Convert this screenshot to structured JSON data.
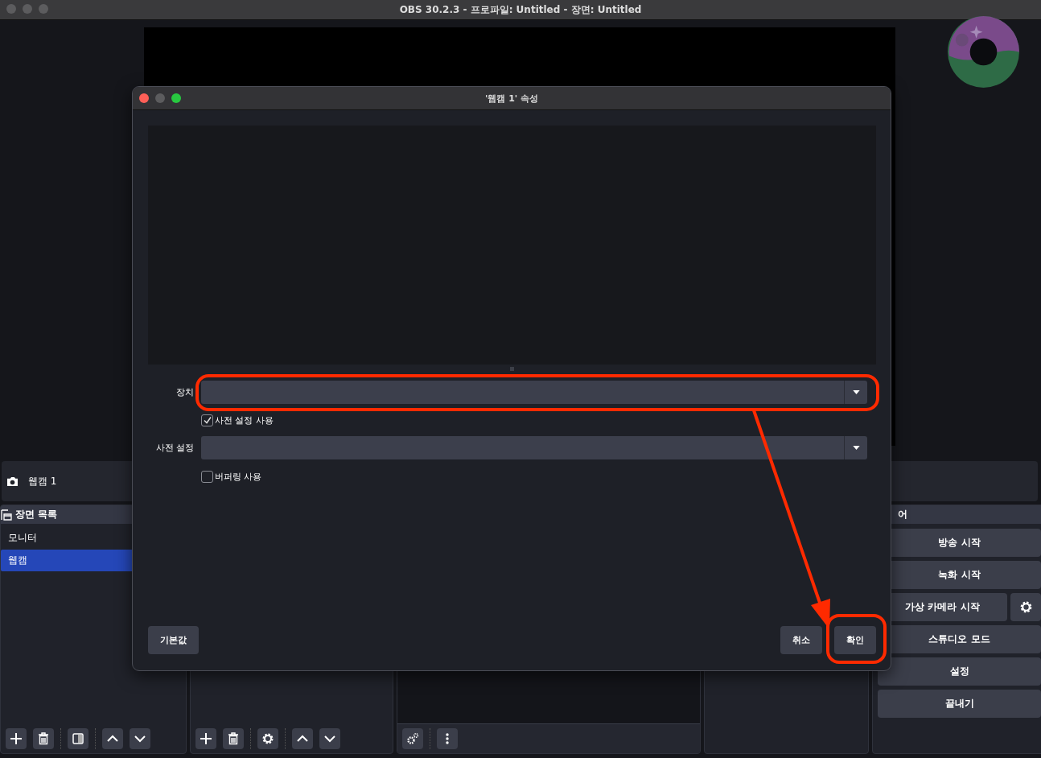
{
  "window": {
    "title": "OBS 30.2.3 - 프로파일: Untitled - 장면: Untitled"
  },
  "source_bar": {
    "source": "웹캠 1"
  },
  "scenes": {
    "title": "장면 목록",
    "items": [
      {
        "label": "모니터",
        "selected": false
      },
      {
        "label": "웹캠",
        "selected": true
      }
    ]
  },
  "controls": {
    "title": "어",
    "buttons": [
      {
        "label": "방송 시작",
        "kind": "plain"
      },
      {
        "label": "녹화 시작",
        "kind": "plain"
      },
      {
        "label": "가상 카메라 시작",
        "kind": "with_settings"
      },
      {
        "label": "스튜디오 모드",
        "kind": "plain"
      },
      {
        "label": "설정",
        "kind": "plain"
      },
      {
        "label": "끝내기",
        "kind": "plain"
      }
    ]
  },
  "dialog": {
    "title": "'웹캠 1' 속성",
    "fields": [
      {
        "kind": "dropdown",
        "label": "장치"
      },
      {
        "kind": "checkbox",
        "label": "사전 설정 사용",
        "checked": true
      },
      {
        "kind": "dropdown",
        "label": "사전 설정"
      },
      {
        "kind": "checkbox",
        "label": "버퍼링 사용",
        "checked": false
      }
    ],
    "defaults_button": "기본값",
    "buttons": [
      "취소",
      "확인"
    ]
  }
}
